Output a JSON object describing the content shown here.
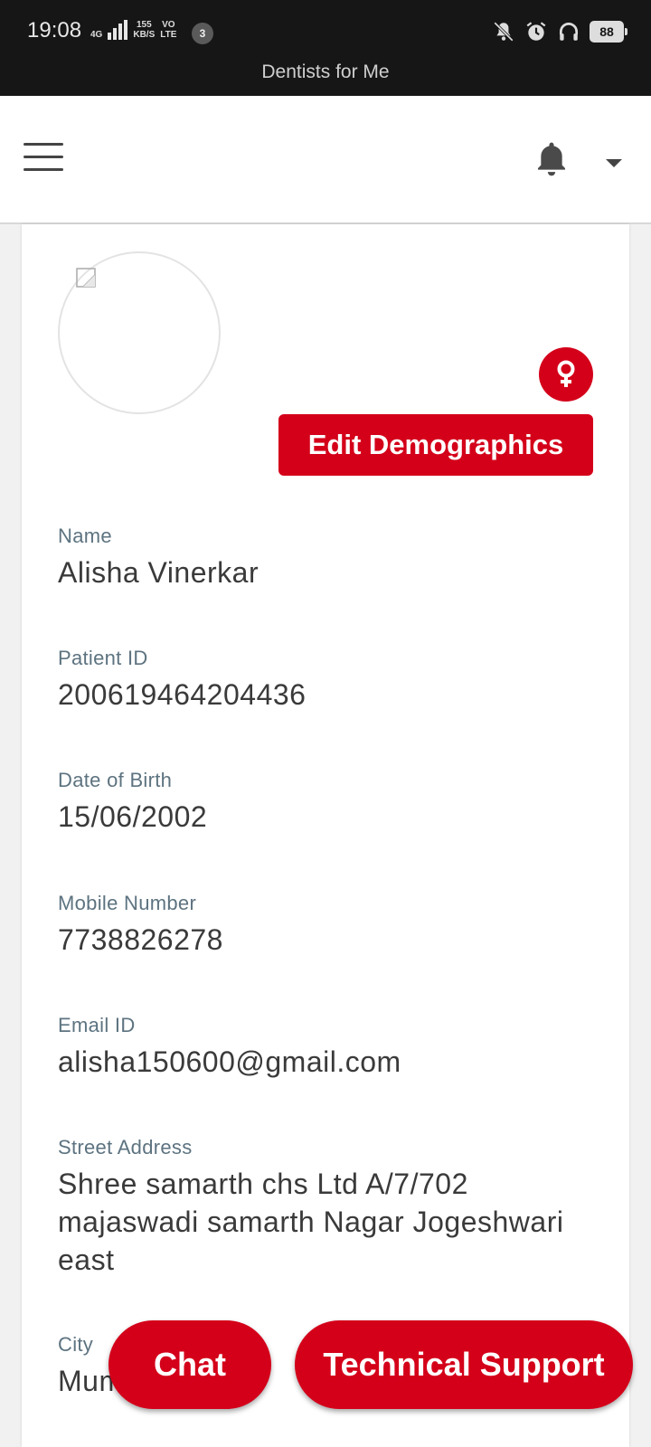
{
  "status_bar": {
    "time": "19:08",
    "network_type": "4G",
    "speed_value": "155",
    "speed_unit": "KB/S",
    "volte_top": "VO",
    "volte_bottom": "LTE",
    "notification_count": "3",
    "battery": "88",
    "app_title": "Dentists for Me"
  },
  "profile": {
    "edit_button_label": "Edit Demographics",
    "fields": [
      {
        "label": "Name",
        "value": "Alisha Vinerkar"
      },
      {
        "label": "Patient ID",
        "value": "200619464204436"
      },
      {
        "label": "Date of Birth",
        "value": "15/06/2002"
      },
      {
        "label": "Mobile Number",
        "value": "7738826278"
      },
      {
        "label": "Email ID",
        "value": "alisha150600@gmail.com"
      },
      {
        "label": "Street Address",
        "value": "Shree samarth chs Ltd A/7/702 majaswadi samarth Nagar Jogeshwari east"
      },
      {
        "label": "City",
        "value": "Mumbai"
      }
    ]
  },
  "floating": {
    "chat_label": "Chat",
    "support_label": "Technical Support"
  },
  "colors": {
    "accent": "#d4001a",
    "label": "#5d7380",
    "value": "#3a3a3a"
  }
}
